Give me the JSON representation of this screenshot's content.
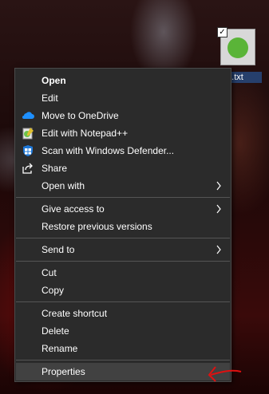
{
  "desktop": {
    "file_label": "t.txt",
    "file_check": "✓"
  },
  "context_menu": {
    "items": [
      {
        "label": "Open"
      },
      {
        "label": "Edit"
      },
      {
        "label": "Move to OneDrive",
        "icon": "onedrive-cloud-icon"
      },
      {
        "label": "Edit with Notepad++",
        "icon": "notepad-plus-plus-icon"
      },
      {
        "label": "Scan with Windows Defender...",
        "icon": "windows-defender-shield-icon"
      },
      {
        "label": "Share",
        "icon": "share-icon"
      },
      {
        "label": "Open with",
        "submenu": true
      },
      {
        "label": "Give access to",
        "submenu": true
      },
      {
        "label": "Restore previous versions"
      },
      {
        "label": "Send to",
        "submenu": true
      },
      {
        "label": "Cut"
      },
      {
        "label": "Copy"
      },
      {
        "label": "Create shortcut"
      },
      {
        "label": "Delete"
      },
      {
        "label": "Rename"
      },
      {
        "label": "Properties",
        "highlighted": true
      }
    ]
  },
  "colors": {
    "menu_background": "#2b2b2b",
    "highlight": "#414141",
    "separator": "#555555",
    "annotation_arrow": "#e01010"
  }
}
